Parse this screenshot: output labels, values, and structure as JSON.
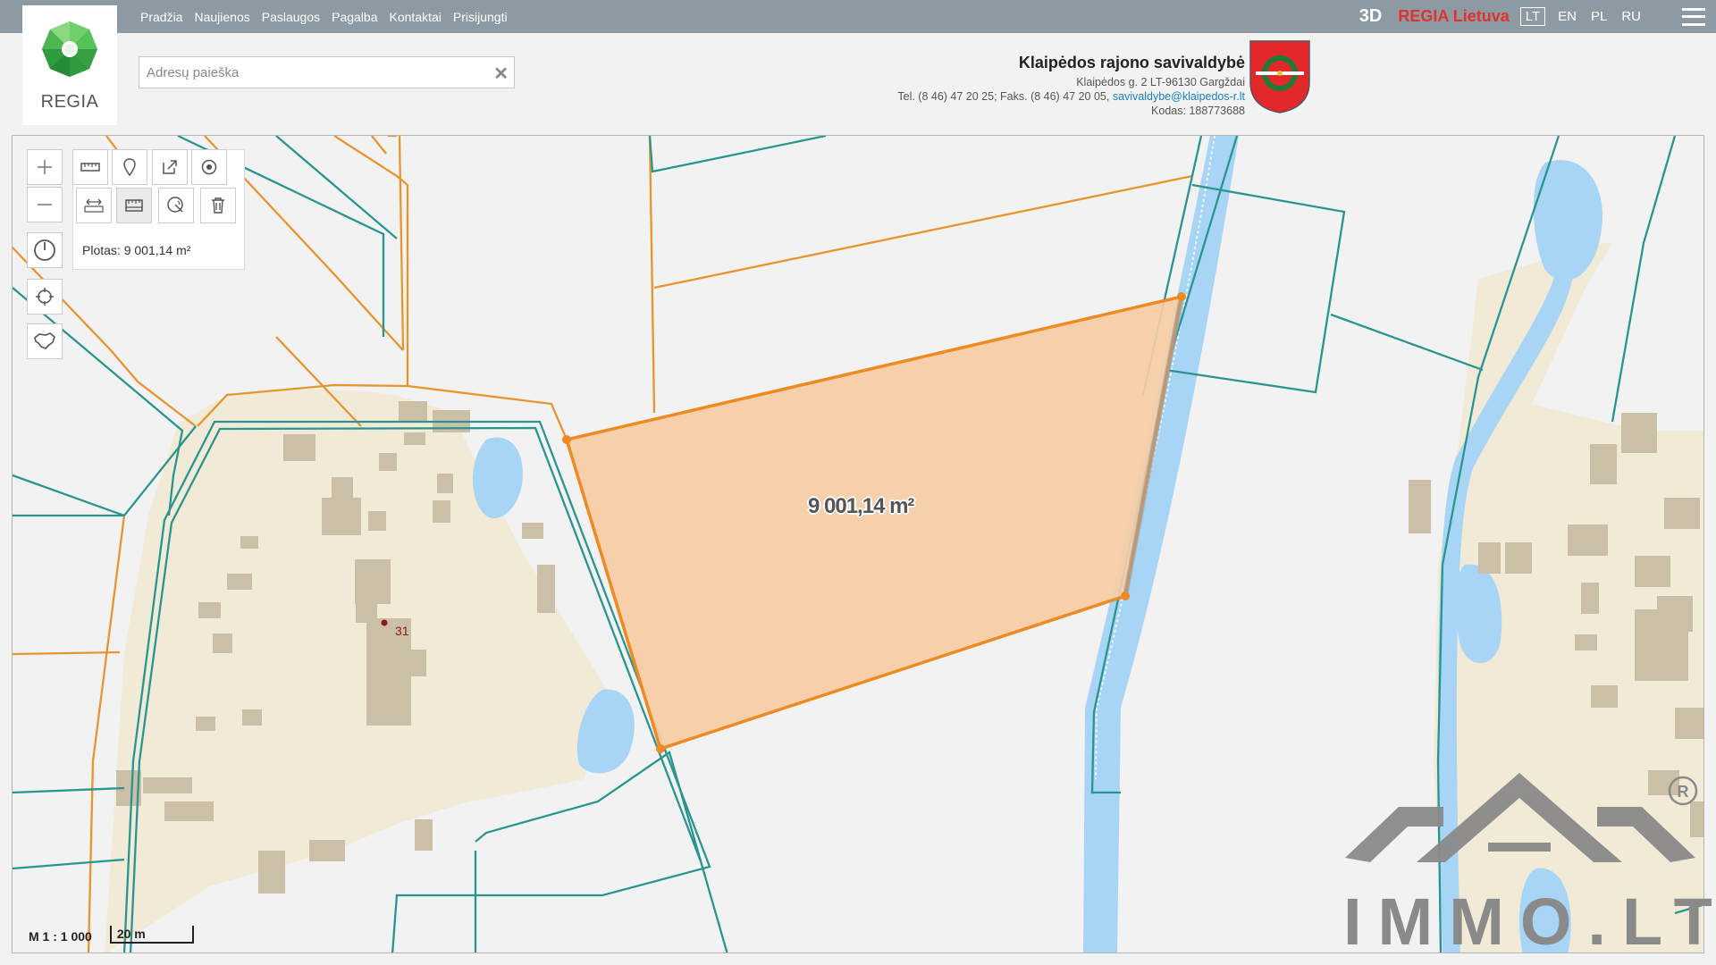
{
  "nav": {
    "items": [
      "Pradžia",
      "Naujienos",
      "Paslaugos",
      "Pagalba",
      "Kontaktai",
      "Prisijungti"
    ]
  },
  "top_right": {
    "btn_3d": "3D",
    "regia_lt": "REGIA Lietuva",
    "languages": [
      "LT",
      "EN",
      "PL",
      "RU"
    ],
    "active_language": "LT"
  },
  "logo": {
    "text": "REGIA"
  },
  "search": {
    "placeholder": "Adresų paieška",
    "value": ""
  },
  "municipality": {
    "name": "Klaipėdos rajono savivaldybė",
    "address": "Klaipėdos g. 2 LT-96130 Gargždai",
    "phone": "Tel. (8 46) 47 20 25; Faks. (8 46) 47 20 05,",
    "email": "savivaldybe@klaipedos-r.lt",
    "code": "Kodas: 188773688"
  },
  "tools": {
    "area_label": "Plotas: 9 001,14 m²"
  },
  "map": {
    "area_value": "9 001,14 m²",
    "parcel_number": "31",
    "scale_ratio": "M 1 : 1 000",
    "scale_bar": "20 m",
    "watermark_text": "IMMO.LT"
  },
  "colors": {
    "topbar": "#8e9aa3",
    "parcel_line": "#2a9590",
    "plot_line": "#e89530",
    "measure_fill": "#f7cda5",
    "measure_line": "#ee8a22",
    "river": "#a8d4f5",
    "building": "#cbbfa8",
    "yard": "#f1ead6"
  }
}
